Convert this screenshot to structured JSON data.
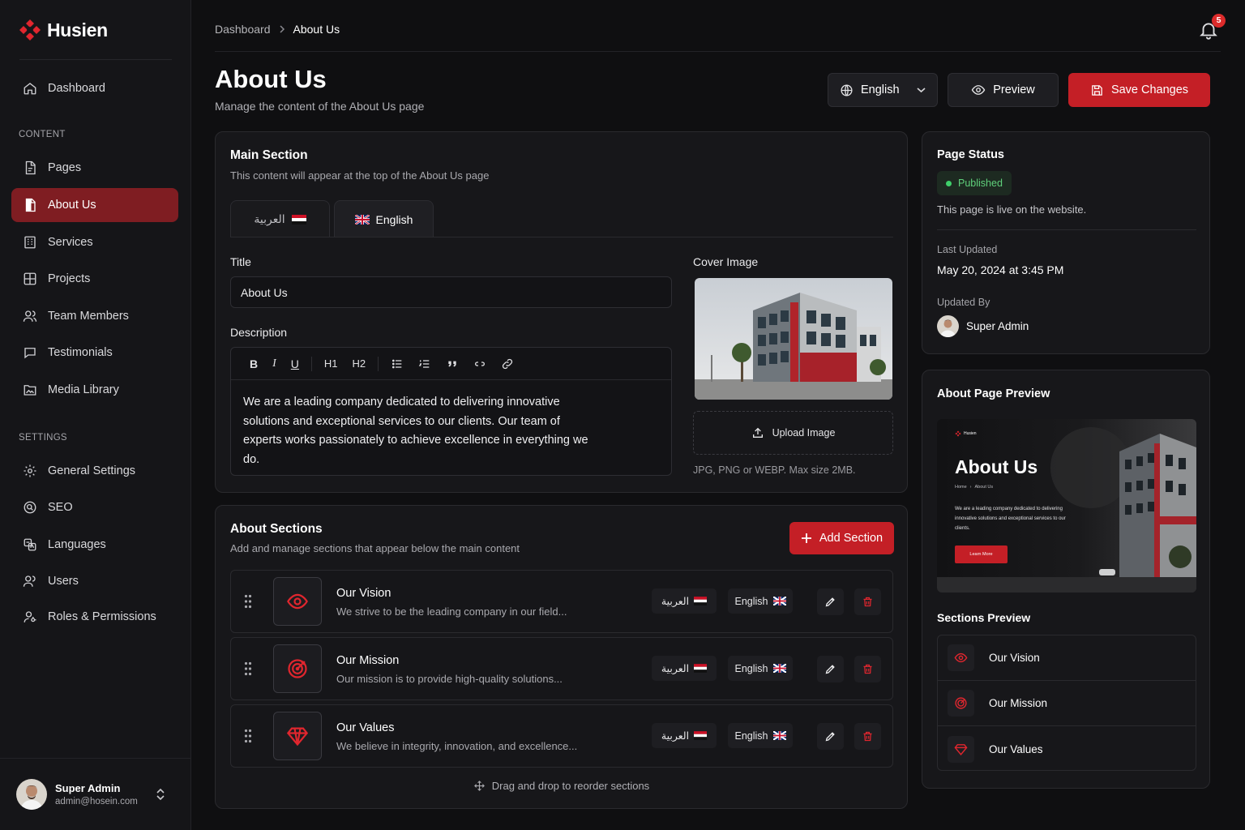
{
  "brand": {
    "name": "Husien",
    "accent": "#c41f26"
  },
  "sidebar": {
    "dashboard": "Dashboard",
    "content_heading": "CONTENT",
    "content_items": [
      {
        "label": "Pages",
        "icon": "file-icon"
      },
      {
        "label": "About Us",
        "icon": "file-icon"
      },
      {
        "label": "Services",
        "icon": "building-icon"
      },
      {
        "label": "Projects",
        "icon": "grid-icon"
      },
      {
        "label": "Team Members",
        "icon": "users-icon"
      },
      {
        "label": "Testimonials",
        "icon": "message-icon"
      },
      {
        "label": "Media Library",
        "icon": "folder-image-icon"
      }
    ],
    "settings_heading": "SETTINGS",
    "settings_items": [
      {
        "label": "General Settings",
        "icon": "gear-icon"
      },
      {
        "label": "SEO",
        "icon": "search-circle-icon"
      },
      {
        "label": "Languages",
        "icon": "translate-icon"
      },
      {
        "label": "Users",
        "icon": "users-icon"
      },
      {
        "label": "Roles & Permissions",
        "icon": "user-key-icon"
      }
    ],
    "user": {
      "name": "Super Admin",
      "email": "admin@hosein.com"
    }
  },
  "breadcrumb": {
    "parent": "Dashboard",
    "current": "About Us"
  },
  "notifications": {
    "count": "5"
  },
  "header": {
    "title": "About Us",
    "subtitle": "Manage the content of the About Us page",
    "language": "English",
    "preview": "Preview",
    "save": "Save Changes"
  },
  "main_section": {
    "title": "Main Section",
    "subtitle": "This content will appear at the top of the About Us page",
    "tabs": [
      "العربية",
      "English"
    ],
    "title_label": "Title",
    "title_value": "About Us",
    "description_label": "Description",
    "toolbar": [
      "B",
      "I",
      "U",
      "H1",
      "H2"
    ],
    "description": "We are a leading company dedicated to delivering innovative solutions and exceptional services to our clients. Our team of experts works passionately to achieve excellence in everything we do.",
    "cover_label": "Cover Image",
    "upload": "Upload Image",
    "upload_hint": "JPG, PNG or WEBP. Max size 2MB."
  },
  "about_sections": {
    "title": "About Sections",
    "subtitle": "Add and manage sections that appear below the main content",
    "add": "Add Section",
    "lang_ar": "العربية",
    "lang_en": "English",
    "items": [
      {
        "title": "Our Vision",
        "desc": "We strive to be the leading company in our field...",
        "icon": "eye-icon"
      },
      {
        "title": "Our Mission",
        "desc": "Our mission is to provide high-quality solutions...",
        "icon": "target-icon"
      },
      {
        "title": "Our Values",
        "desc": "We believe in integrity, innovation, and excellence...",
        "icon": "diamond-icon"
      }
    ],
    "reorder_hint": "Drag and drop to reorder sections"
  },
  "page_status": {
    "title": "Page Status",
    "status": "Published",
    "status_text": "This page is live on the website.",
    "last_updated_label": "Last Updated",
    "last_updated": "May 20, 2024 at 3:45 PM",
    "updated_by_label": "Updated By",
    "updated_by": "Super Admin"
  },
  "preview": {
    "title": "About Page Preview",
    "mini": {
      "brand": "Husien",
      "heading": "About Us",
      "crumb_home": "Home",
      "crumb_cur": "About Us",
      "text": "We are a leading company dedicated to delivering innovative solutions and exceptional services to our clients.",
      "button": "Learn More"
    },
    "sections_title": "Sections Preview",
    "sections": [
      "Our Vision",
      "Our Mission",
      "Our Values"
    ]
  }
}
